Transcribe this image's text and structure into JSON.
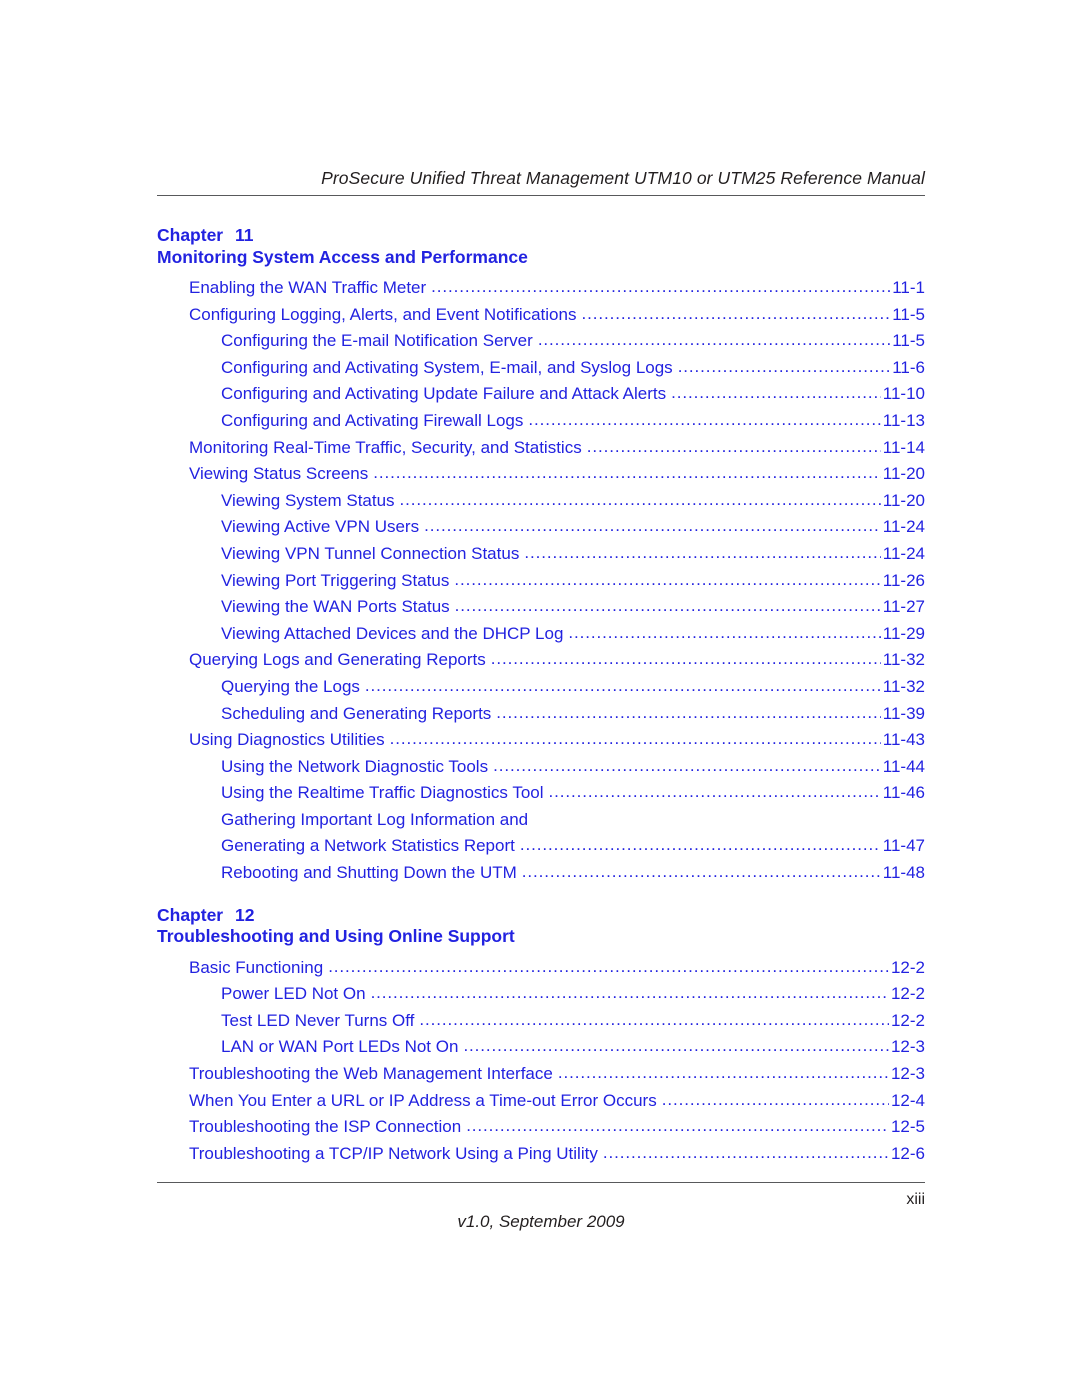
{
  "document": {
    "running_header": "ProSecure Unified Threat Management UTM10 or UTM25 Reference Manual",
    "folio": "xiii",
    "version_footer": "v1.0, September 2009",
    "accent_color": "#2222e0",
    "rule_color": "#58595b",
    "text_color": "#231f20"
  },
  "chapters": [
    {
      "chapter_word": "Chapter",
      "chapter_number": "11",
      "chapter_title": "Monitoring System Access and Performance",
      "entries": [
        {
          "level": 1,
          "title": "Enabling the WAN Traffic Meter",
          "page": "11-1",
          "dots": true
        },
        {
          "level": 1,
          "title": "Configuring Logging, Alerts, and Event Notifications",
          "page": "11-5",
          "dots": true
        },
        {
          "level": 2,
          "title": "Configuring the E-mail Notification Server",
          "page": "11-5",
          "dots": true
        },
        {
          "level": 2,
          "title": "Configuring and Activating System, E-mail, and Syslog Logs",
          "page": "11-6",
          "dots": true
        },
        {
          "level": 2,
          "title": "Configuring and Activating Update Failure and Attack Alerts",
          "page": "11-10",
          "dots": true
        },
        {
          "level": 2,
          "title": "Configuring and Activating Firewall Logs",
          "page": "11-13",
          "dots": true
        },
        {
          "level": 1,
          "title": "Monitoring Real-Time Traffic, Security, and Statistics",
          "page": "11-14",
          "dots": true
        },
        {
          "level": 1,
          "title": "Viewing Status Screens",
          "page": "11-20",
          "dots": true
        },
        {
          "level": 2,
          "title": "Viewing System Status",
          "page": "11-20",
          "dots": true
        },
        {
          "level": 2,
          "title": "Viewing Active VPN Users",
          "page": "11-24",
          "dots": true
        },
        {
          "level": 2,
          "title": "Viewing VPN Tunnel Connection Status",
          "page": "11-24",
          "dots": true
        },
        {
          "level": 2,
          "title": "Viewing Port Triggering Status",
          "page": "11-26",
          "dots": true
        },
        {
          "level": 2,
          "title": "Viewing the WAN Ports Status",
          "page": "11-27",
          "dots": true
        },
        {
          "level": 2,
          "title": "Viewing Attached Devices and the DHCP Log",
          "page": "11-29",
          "dots": true
        },
        {
          "level": 1,
          "title": "Querying Logs and Generating Reports",
          "page": "11-32",
          "dots": true
        },
        {
          "level": 2,
          "title": "Querying the Logs",
          "page": "11-32",
          "dots": true
        },
        {
          "level": 2,
          "title": "Scheduling and Generating Reports",
          "page": "11-39",
          "dots": true
        },
        {
          "level": 1,
          "title": "Using Diagnostics Utilities",
          "page": "11-43",
          "dots": true
        },
        {
          "level": 2,
          "title": "Using the Network Diagnostic Tools",
          "page": "11-44",
          "dots": true
        },
        {
          "level": 2,
          "title": "Using the Realtime Traffic Diagnostics Tool",
          "page": "11-46",
          "dots": true
        },
        {
          "level": 2,
          "title": "Gathering Important Log Information and",
          "page": "",
          "dots": false
        },
        {
          "level": 2,
          "title": "Generating a Network Statistics Report",
          "page": "11-47",
          "dots": true
        },
        {
          "level": 2,
          "title": "Rebooting and Shutting Down the UTM",
          "page": "11-48",
          "dots": true
        }
      ]
    },
    {
      "chapter_word": "Chapter",
      "chapter_number": "12",
      "chapter_title": "Troubleshooting and Using Online Support",
      "entries": [
        {
          "level": 1,
          "title": "Basic Functioning",
          "page": "12-2",
          "dots": true
        },
        {
          "level": 2,
          "title": "Power LED Not On",
          "page": "12-2",
          "dots": true
        },
        {
          "level": 2,
          "title": "Test LED Never Turns Off",
          "page": "12-2",
          "dots": true
        },
        {
          "level": 2,
          "title": "LAN or WAN Port LEDs Not On",
          "page": "12-3",
          "dots": true
        },
        {
          "level": 1,
          "title": "Troubleshooting the Web Management Interface",
          "page": "12-3",
          "dots": true
        },
        {
          "level": 1,
          "title": "When You Enter a URL or IP Address a Time-out Error Occurs",
          "page": "12-4",
          "dots": true
        },
        {
          "level": 1,
          "title": "Troubleshooting the ISP Connection",
          "page": "12-5",
          "dots": true
        },
        {
          "level": 1,
          "title": "Troubleshooting a TCP/IP Network Using a Ping Utility",
          "page": "12-6",
          "dots": true
        }
      ]
    }
  ]
}
